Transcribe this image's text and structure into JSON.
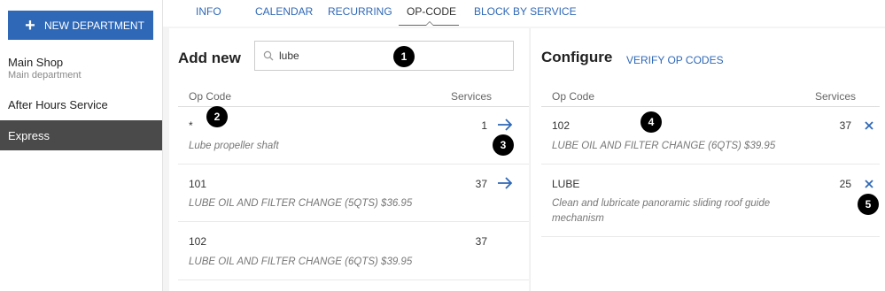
{
  "sidebar": {
    "new_department_label": "NEW DEPARTMENT",
    "departments": [
      {
        "name": "Main Shop",
        "subtitle": "Main department"
      },
      {
        "name": "After Hours Service",
        "subtitle": ""
      },
      {
        "name": "Express",
        "subtitle": ""
      }
    ],
    "selected": "Express"
  },
  "tabs": [
    {
      "label": "INFO"
    },
    {
      "label": "CALENDAR"
    },
    {
      "label": "RECURRING"
    },
    {
      "label": "OP-CODE"
    },
    {
      "label": "BLOCK BY SERVICE"
    }
  ],
  "active_tab": "OP-CODE",
  "add_new": {
    "heading": "Add new",
    "search_value": "lube",
    "columns": {
      "op_code": "Op Code",
      "services": "Services"
    },
    "rows": [
      {
        "code": "*",
        "description": "Lube propeller shaft",
        "services": "1",
        "action_icon": "arrow-right-icon"
      },
      {
        "code": "101",
        "description": "LUBE OIL AND FILTER CHANGE (5QTS) $36.95",
        "services": "37",
        "action_icon": "arrow-right-icon"
      },
      {
        "code": "102",
        "description": "LUBE OIL AND FILTER CHANGE (6QTS) $39.95",
        "services": "37",
        "action_icon": ""
      }
    ]
  },
  "configure": {
    "heading": "Configure",
    "verify_label": "VERIFY OP CODES",
    "columns": {
      "op_code": "Op Code",
      "services": "Services"
    },
    "rows": [
      {
        "code": "102",
        "description": "LUBE OIL AND FILTER CHANGE (6QTS) $39.95",
        "services": "37",
        "action_icon": "close-icon"
      },
      {
        "code": "LUBE",
        "description": "Clean and lubricate panoramic sliding roof guide mechanism",
        "services": "25",
        "action_icon": "close-icon"
      }
    ]
  },
  "callouts": [
    "1",
    "2",
    "3",
    "4",
    "5"
  ],
  "colors": {
    "accent": "#2f68b7",
    "selected_bg": "#4a4a4a",
    "callout": "#000000"
  }
}
